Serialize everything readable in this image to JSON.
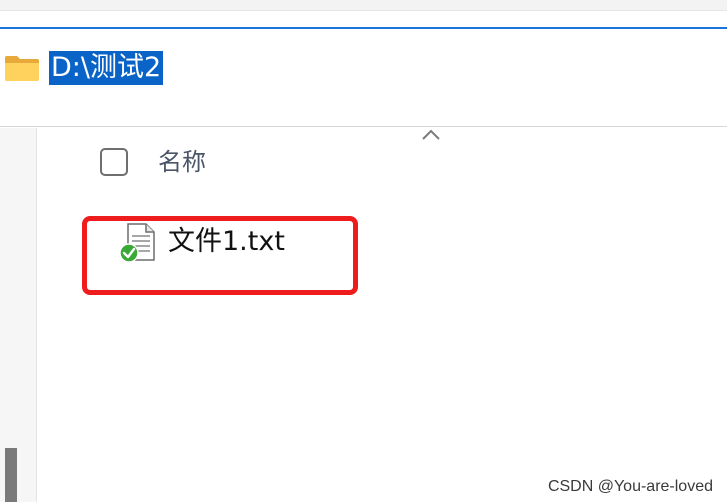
{
  "address_bar": {
    "path": "D:\\测试2",
    "icon": "folder-icon"
  },
  "file_list": {
    "columns": [
      {
        "label": "名称",
        "sort_indicator": "chevron-up-icon"
      }
    ],
    "rows": [
      {
        "name": "文件1.txt",
        "icon": "text-file-synced-icon"
      }
    ]
  },
  "annotation": {
    "highlight_color": "#ee1c1c"
  },
  "watermark": {
    "text": "CSDN @You-are-loved"
  },
  "colors": {
    "selection": "#0a64c8",
    "focus_border": "#1a73d9"
  }
}
